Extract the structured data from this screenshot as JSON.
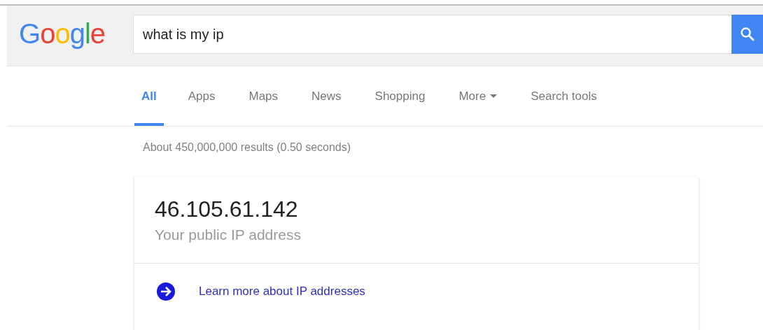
{
  "logo": {
    "text": "Google"
  },
  "search": {
    "value": "what is my ip"
  },
  "tabs": [
    {
      "label": "All",
      "selected": true,
      "dropdown": false
    },
    {
      "label": "Apps",
      "selected": false,
      "dropdown": false
    },
    {
      "label": "Maps",
      "selected": false,
      "dropdown": false
    },
    {
      "label": "News",
      "selected": false,
      "dropdown": false
    },
    {
      "label": "Shopping",
      "selected": false,
      "dropdown": false
    },
    {
      "label": "More",
      "selected": false,
      "dropdown": true
    },
    {
      "label": "Search tools",
      "selected": false,
      "dropdown": false
    }
  ],
  "result_stats": "About 450,000,000 results (0.50 seconds)",
  "ip_card": {
    "ip": "46.105.61.142",
    "caption": "Your public IP address",
    "link": "Learn more about IP addresses"
  }
}
